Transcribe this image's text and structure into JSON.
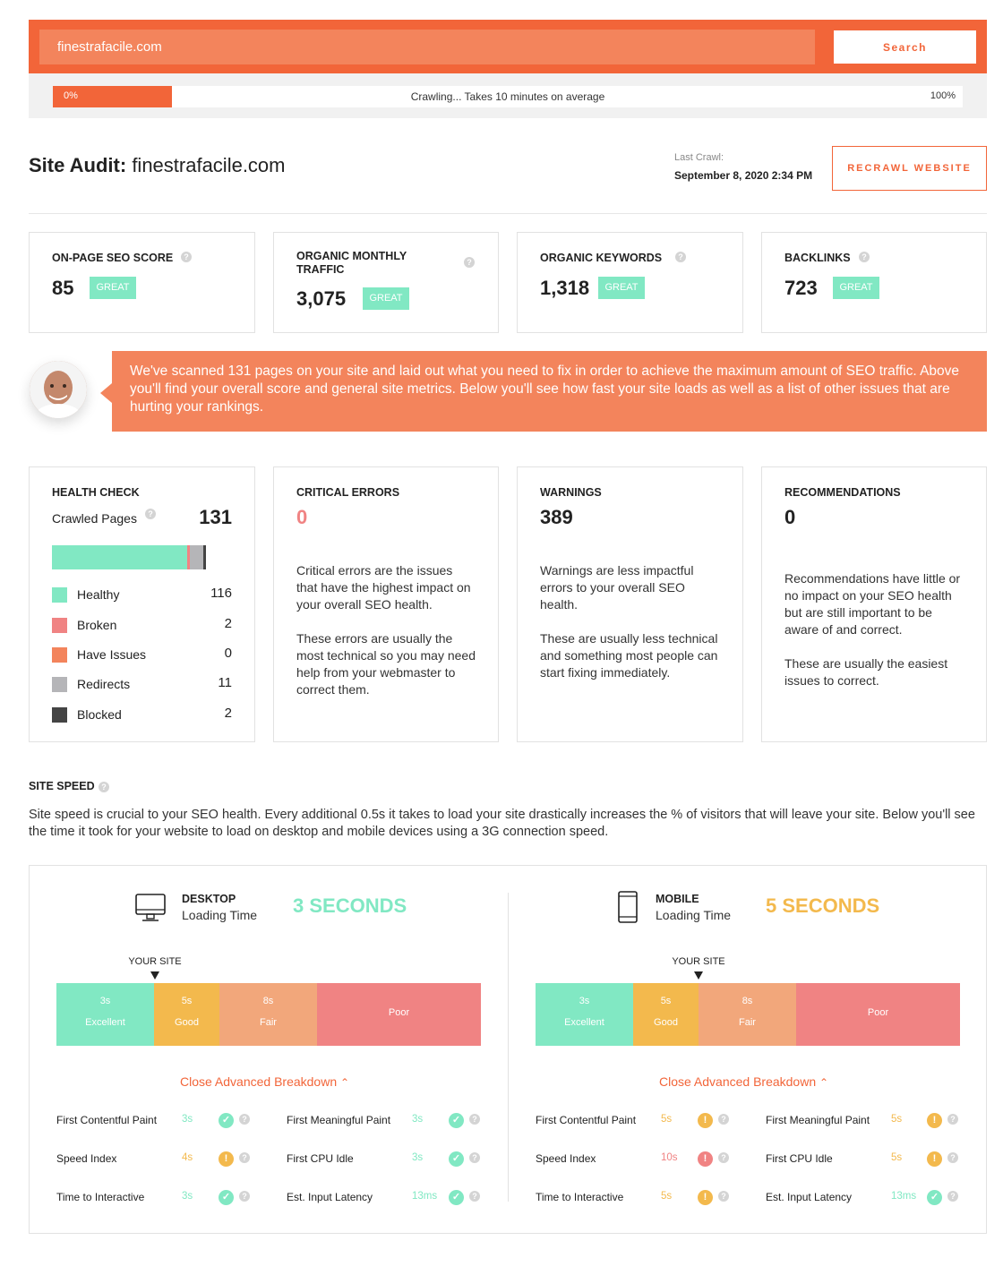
{
  "search": {
    "value": "finestrafacile.com",
    "button_label": "Search"
  },
  "progress": {
    "percent": 0,
    "left_label": "0%",
    "status": "Crawling... Takes 10 minutes on average",
    "right_label": "100%"
  },
  "audit": {
    "title_prefix": "Site Audit:",
    "domain": "finestrafacile.com",
    "last_crawl_label": "Last Crawl:",
    "last_crawl_date": "September 8, 2020 2:34 PM",
    "recrawl_label": "RECRAWL WEBSITE"
  },
  "metrics": [
    {
      "title": "ON-PAGE SEO SCORE",
      "value": "85",
      "badge": "GREAT"
    },
    {
      "title": "ORGANIC MONTHLY TRAFFIC",
      "value": "3,075",
      "badge": "GREAT"
    },
    {
      "title": "ORGANIC KEYWORDS",
      "value": "1,318",
      "badge": "GREAT"
    },
    {
      "title": "BACKLINKS",
      "value": "723",
      "badge": "GREAT"
    }
  ],
  "message": "We've scanned 131 pages on your site and laid out what you need to fix in order to achieve the maximum amount of SEO traffic. Above you'll find your overall score and general site metrics. Below you'll see how fast your site loads as well as a list of other issues that are hurting your rankings.",
  "health": {
    "title": "HEALTH CHECK",
    "crawled_label": "Crawled Pages",
    "crawled_value": "131",
    "items": [
      {
        "label": "Healthy",
        "value": "116",
        "color": "#81e8c3"
      },
      {
        "label": "Broken",
        "value": "2",
        "color": "#f08383"
      },
      {
        "label": "Have Issues",
        "value": "0",
        "color": "#f3845c"
      },
      {
        "label": "Redirects",
        "value": "11",
        "color": "#b5b5b8"
      },
      {
        "label": "Blocked",
        "value": "2",
        "color": "#444444"
      }
    ]
  },
  "critical": {
    "title": "CRITICAL ERRORS",
    "value": "0",
    "p1": "Critical errors are the issues that have the highest impact on your overall SEO health.",
    "p2": "These errors are usually the most technical so you may need help from your webmaster to correct them."
  },
  "warnings": {
    "title": "WARNINGS",
    "value": "389",
    "p1": "Warnings are less impactful errors to your overall SEO health.",
    "p2": "These are usually less technical and something most people can start fixing immediately."
  },
  "recommendations": {
    "title": "RECOMMENDATIONS",
    "value": "0",
    "p1": "Recommendations have little or no impact on your SEO health but are still important to be aware of and correct.",
    "p2": "These are usually the easiest issues to correct."
  },
  "site_speed": {
    "title": "SITE SPEED",
    "description": "Site speed is crucial to your SEO health. Every additional 0.5s it takes to load your site drastically increases the % of visitors that will leave your site. Below you'll see the time it took for your website to load on desktop and mobile devices using a 3G connection speed.",
    "your_site_label": "YOUR SITE",
    "close_label": "Close Advanced Breakdown",
    "scale": {
      "s3": "3s",
      "excellent": "Excellent",
      "s5": "5s",
      "good": "Good",
      "s8": "8s",
      "fair": "Fair",
      "poor": "Poor"
    },
    "desktop": {
      "title": "DESKTOP",
      "subtitle": "Loading Time",
      "time": "3 SECONDS",
      "time_color": "#81e8c3",
      "seconds": 3,
      "metrics": [
        {
          "label": "First Contentful Paint",
          "value": "3s",
          "status": "good"
        },
        {
          "label": "First Meaningful Paint",
          "value": "3s",
          "status": "good"
        },
        {
          "label": "Speed Index",
          "value": "4s",
          "status": "warn"
        },
        {
          "label": "First CPU Idle",
          "value": "3s",
          "status": "good"
        },
        {
          "label": "Time to Interactive",
          "value": "3s",
          "status": "good"
        },
        {
          "label": "Est. Input Latency",
          "value": "13ms",
          "status": "good"
        }
      ]
    },
    "mobile": {
      "title": "MOBILE",
      "subtitle": "Loading Time",
      "time": "5 SECONDS",
      "time_color": "#f3b94d",
      "seconds": 5,
      "metrics": [
        {
          "label": "First Contentful Paint",
          "value": "5s",
          "status": "warn"
        },
        {
          "label": "First Meaningful Paint",
          "value": "5s",
          "status": "warn"
        },
        {
          "label": "Speed Index",
          "value": "10s",
          "status": "bad"
        },
        {
          "label": "First CPU Idle",
          "value": "5s",
          "status": "warn"
        },
        {
          "label": "Time to Interactive",
          "value": "5s",
          "status": "warn"
        },
        {
          "label": "Est. Input Latency",
          "value": "13ms",
          "status": "good"
        }
      ]
    }
  },
  "colors": {
    "accent": "#f26539",
    "excellent": "#81e8c3",
    "good": "#f3b94d",
    "fair": "#f2a77b",
    "poor": "#f08383"
  }
}
